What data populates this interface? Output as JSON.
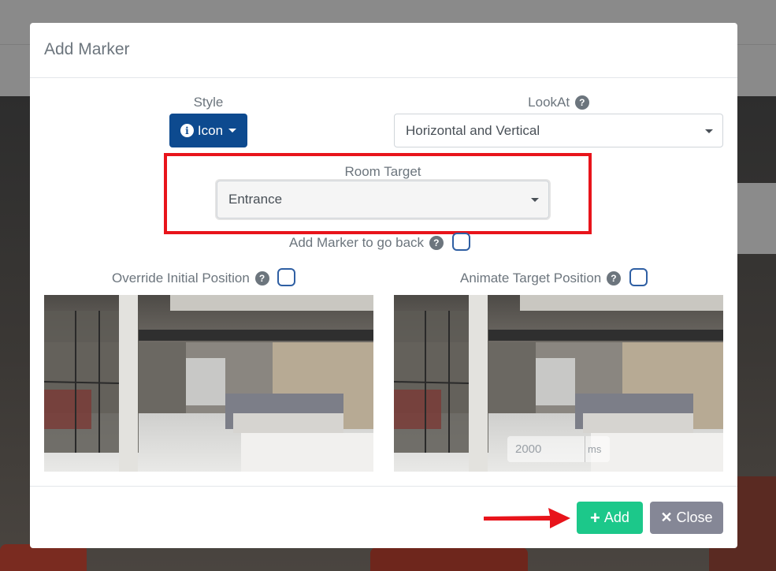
{
  "modal": {
    "title": "Add Marker"
  },
  "style": {
    "label": "Style",
    "button_label": "Icon",
    "button_icon": "info-circle-icon"
  },
  "lookat": {
    "label": "LookAt",
    "help": "?",
    "value": "Horizontal and Vertical"
  },
  "room_target": {
    "label": "Room Target",
    "value": "Entrance"
  },
  "go_back": {
    "label": "Add Marker to go back",
    "help": "?"
  },
  "override": {
    "label": "Override Initial Position",
    "help": "?"
  },
  "animate": {
    "label": "Animate Target Position",
    "help": "?",
    "duration_value": "2000",
    "duration_unit": "ms"
  },
  "footer": {
    "add_label": "Add",
    "add_icon": "+",
    "close_label": "Close",
    "close_icon": "✕"
  },
  "colors": {
    "primary": "#0d4a8f",
    "success": "#1cc88a",
    "secondary": "#858796",
    "highlight": "#e8141b"
  }
}
